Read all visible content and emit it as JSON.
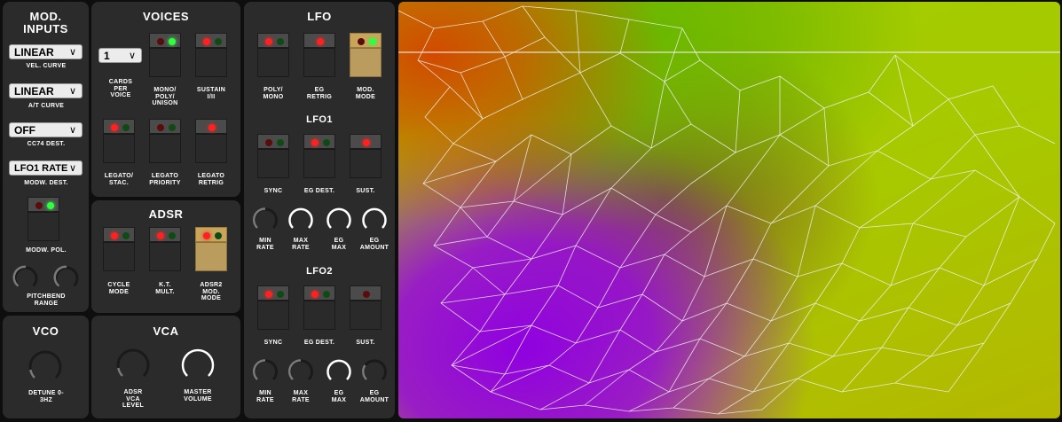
{
  "mod_inputs": {
    "title": "MOD. INPUTS",
    "selects": [
      {
        "value": "LINEAR",
        "label": "VEL. CURVE"
      },
      {
        "value": "LINEAR",
        "label": "A/T CURVE"
      },
      {
        "value": "OFF",
        "label": "CC74 DEST."
      },
      {
        "value": "LFO1 RATE",
        "label": "MODW. DEST."
      }
    ],
    "switch_label": "MODW. POL.",
    "knob_label": "PITCHBEND RANGE"
  },
  "voices": {
    "title": "VOICES",
    "cards_value": "1",
    "cards_label": "CARDS PER VOICE",
    "switches": [
      "MONO/ POLY/ UNISON",
      "SUSTAIN I/II",
      "LEGATO/ STAC.",
      "LEGATO PRIORITY",
      "LEGATO RETRIG"
    ]
  },
  "adsr": {
    "title": "ADSR",
    "switches": [
      "CYCLE MODE",
      "K.T. MULT.",
      "ADSR2 MOD. MODE"
    ]
  },
  "vco": {
    "title": "VCO",
    "knob_label": "DETUNE 0-3HZ"
  },
  "vca": {
    "title": "VCA",
    "knobs": [
      "ADSR VCA LEVEL",
      "MASTER VOLUME"
    ]
  },
  "lfo": {
    "title": "LFO",
    "switches": [
      "POLY/ MONO",
      "EG RETRIG",
      "MOD. MODE"
    ],
    "lfo1": {
      "title": "LFO1",
      "switches": [
        "SYNC",
        "EG DEST.",
        "SUST."
      ],
      "knobs": [
        "MIN RATE",
        "MAX RATE",
        "EG MAX",
        "EG AMOUNT"
      ]
    },
    "lfo2": {
      "title": "LFO2",
      "switches": [
        "SYNC",
        "EG DEST.",
        "SUST."
      ],
      "knobs": [
        "MIN RATE",
        "MAX RATE",
        "EG MAX",
        "EG AMOUNT"
      ]
    }
  },
  "colors": {
    "panel": "#2b2b2b",
    "led_red_on": "#ff2020",
    "led_green_on": "#30ff40",
    "led_red_off": "#5a0c0c",
    "led_green_off": "#0f4a14",
    "switch_active": "#c9a55c",
    "wire": "#f2f2f2"
  }
}
